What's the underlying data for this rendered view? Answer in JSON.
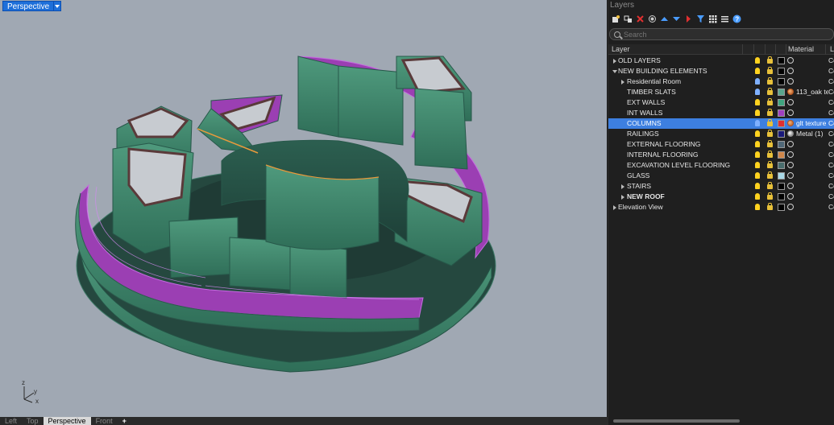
{
  "viewport": {
    "title": "Perspective",
    "axes": {
      "z": "z",
      "y": "y",
      "x": "x"
    },
    "tabs": [
      {
        "label": "Left"
      },
      {
        "label": "Top"
      },
      {
        "label": "Perspective"
      },
      {
        "label": "Front"
      },
      {
        "label": "+"
      }
    ]
  },
  "layers_panel": {
    "title": "Layers",
    "search_placeholder": "Search",
    "columns": {
      "layer": "Layer",
      "material": "Material",
      "linetype": "L"
    },
    "toolbar_icons": [
      "new-layer-icon",
      "new-sublayer-icon",
      "delete-icon",
      "copy-icon",
      "move-up-icon",
      "move-down-icon",
      "move-to-parent-icon",
      "filter-icon",
      "grid-icon",
      "list-icon",
      "help-icon"
    ],
    "rows": [
      {
        "label": "OLD LAYERS",
        "indent": 0,
        "expander": "right",
        "bulb": "yellow",
        "swatch": "#000000",
        "material": "",
        "linetype": "Co"
      },
      {
        "label": "NEW BUILDING ELEMENTS",
        "indent": 0,
        "expander": "down",
        "bulb": "yellow",
        "swatch": "#000000",
        "material": "",
        "linetype": "Co"
      },
      {
        "label": "Residential Room",
        "indent": 1,
        "expander": "right",
        "bulb": "blue",
        "swatch": "#000000",
        "material": "",
        "linetype": "Co"
      },
      {
        "label": "TIMBER SLATS",
        "indent": 1,
        "expander": "",
        "bulb": "blue",
        "swatch": "#5aa58d",
        "material": "113_oak tex",
        "mat_icon": "filled",
        "linetype": "Co"
      },
      {
        "label": "EXT WALLS",
        "indent": 1,
        "expander": "",
        "bulb": "yellow",
        "swatch": "#3fa57f",
        "material": "",
        "linetype": "Co"
      },
      {
        "label": "INT WALLS",
        "indent": 1,
        "expander": "",
        "bulb": "yellow",
        "swatch": "#a040c0",
        "material": "",
        "linetype": "Co"
      },
      {
        "label": "COLUMNS",
        "indent": 1,
        "expander": "",
        "bulb": "blue",
        "swatch": "#e03030",
        "material": "glt texture",
        "mat_icon": "filled",
        "linetype": "Co",
        "selected": true
      },
      {
        "label": "RAILINGS",
        "indent": 1,
        "expander": "",
        "bulb": "yellow",
        "swatch": "#1a1a7a",
        "material": "Metal (1)",
        "mat_icon": "metal",
        "linetype": "Co"
      },
      {
        "label": "EXTERNAL FLOORING",
        "indent": 1,
        "expander": "",
        "bulb": "yellow",
        "swatch": "#506878",
        "material": "",
        "linetype": "Co"
      },
      {
        "label": "INTERNAL FLOORING",
        "indent": 1,
        "expander": "",
        "bulb": "yellow",
        "swatch": "#d0874a",
        "material": "",
        "linetype": "Co"
      },
      {
        "label": "EXCAVATION LEVEL FLOORING",
        "indent": 1,
        "expander": "",
        "bulb": "yellow",
        "swatch": "#4a6e6e",
        "material": "",
        "linetype": "Co"
      },
      {
        "label": "GLASS",
        "indent": 1,
        "expander": "",
        "bulb": "yellow",
        "swatch": "#a8d8e6",
        "material": "",
        "linetype": "Co"
      },
      {
        "label": "STAIRS",
        "indent": 1,
        "expander": "right",
        "bulb": "yellow",
        "swatch": "#000000",
        "material": "",
        "linetype": "Co"
      },
      {
        "label": "NEW ROOF",
        "indent": 1,
        "expander": "right",
        "bulb": "yellow",
        "swatch": "#000000",
        "material": "",
        "linetype": "Co",
        "bold": true
      },
      {
        "label": "Elevation View",
        "indent": 0,
        "expander": "right",
        "bulb": "yellow",
        "swatch": "#000000",
        "material": "",
        "linetype": "Co"
      }
    ]
  }
}
